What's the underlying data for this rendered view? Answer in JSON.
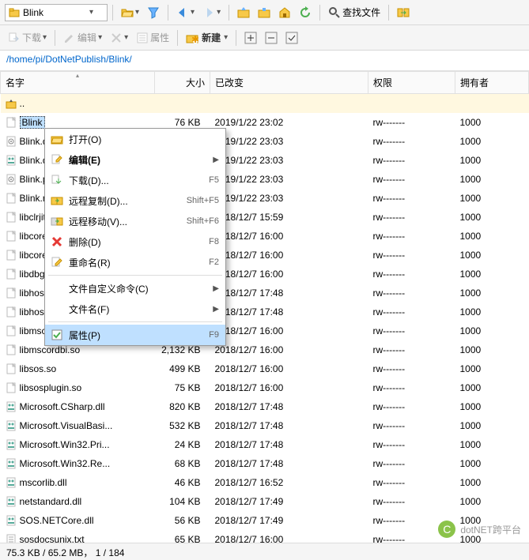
{
  "toolbar": {
    "folder_name": "Blink",
    "find_files": "查找文件"
  },
  "toolbar2": {
    "download": "下载",
    "edit": "编辑",
    "properties": "属性",
    "new": "新建"
  },
  "path": "/home/pi/DotNetPublish/Blink/",
  "columns": {
    "name": "名字",
    "size": "大小",
    "changed": "已改变",
    "perm": "权限",
    "owner": "拥有者"
  },
  "parent_row": "..",
  "files": [
    {
      "name": "Blink",
      "size": "76 KB",
      "changed": "2019/1/22 23:02",
      "perm": "rw-------",
      "owner": "1000",
      "icon": "file",
      "selected": true
    },
    {
      "name": "Blink.deps.json",
      "size": "",
      "changed": "2019/1/22 23:03",
      "perm": "rw-------",
      "owner": "1000",
      "icon": "config"
    },
    {
      "name": "Blink.dll",
      "size": "",
      "changed": "2019/1/22 23:03",
      "perm": "rw-------",
      "owner": "1000",
      "icon": "dll"
    },
    {
      "name": "Blink.pdb",
      "size": "",
      "changed": "2019/1/22 23:03",
      "perm": "rw-------",
      "owner": "1000",
      "icon": "config"
    },
    {
      "name": "Blink.runtimeconfig...",
      "size": "",
      "changed": "2019/1/22 23:03",
      "perm": "rw-------",
      "owner": "1000",
      "icon": "file"
    },
    {
      "name": "libclrjit.so",
      "size": "",
      "changed": "2018/12/7 15:59",
      "perm": "rw-------",
      "owner": "1000",
      "icon": "file"
    },
    {
      "name": "libcoreclr.so",
      "size": "",
      "changed": "2018/12/7 16:00",
      "perm": "rw-------",
      "owner": "1000",
      "icon": "file"
    },
    {
      "name": "libcoreclrtracept...",
      "size": "",
      "changed": "2018/12/7 16:00",
      "perm": "rw-------",
      "owner": "1000",
      "icon": "file"
    },
    {
      "name": "libdbgshim.so",
      "size": "",
      "changed": "2018/12/7 16:00",
      "perm": "rw-------",
      "owner": "1000",
      "icon": "file"
    },
    {
      "name": "libhostfxr.so",
      "size": "",
      "changed": "2018/12/7 17:48",
      "perm": "rw-------",
      "owner": "1000",
      "icon": "file"
    },
    {
      "name": "libhostpolicy.so",
      "size": "",
      "changed": "2018/12/7 17:48",
      "perm": "rw-------",
      "owner": "1000",
      "icon": "file"
    },
    {
      "name": "libmscordaccore.so",
      "size": "",
      "changed": "2018/12/7 16:00",
      "perm": "rw-------",
      "owner": "1000",
      "icon": "file"
    },
    {
      "name": "libmscordbi.so",
      "size": "2,132 KB",
      "changed": "2018/12/7 16:00",
      "perm": "rw-------",
      "owner": "1000",
      "icon": "file"
    },
    {
      "name": "libsos.so",
      "size": "499 KB",
      "changed": "2018/12/7 16:00",
      "perm": "rw-------",
      "owner": "1000",
      "icon": "file"
    },
    {
      "name": "libsosplugin.so",
      "size": "75 KB",
      "changed": "2018/12/7 16:00",
      "perm": "rw-------",
      "owner": "1000",
      "icon": "file"
    },
    {
      "name": "Microsoft.CSharp.dll",
      "size": "820 KB",
      "changed": "2018/12/7 17:48",
      "perm": "rw-------",
      "owner": "1000",
      "icon": "dll"
    },
    {
      "name": "Microsoft.VisualBasi...",
      "size": "532 KB",
      "changed": "2018/12/7 17:48",
      "perm": "rw-------",
      "owner": "1000",
      "icon": "dll"
    },
    {
      "name": "Microsoft.Win32.Pri...",
      "size": "24 KB",
      "changed": "2018/12/7 17:48",
      "perm": "rw-------",
      "owner": "1000",
      "icon": "dll"
    },
    {
      "name": "Microsoft.Win32.Re...",
      "size": "68 KB",
      "changed": "2018/12/7 17:48",
      "perm": "rw-------",
      "owner": "1000",
      "icon": "dll"
    },
    {
      "name": "mscorlib.dll",
      "size": "46 KB",
      "changed": "2018/12/7 16:52",
      "perm": "rw-------",
      "owner": "1000",
      "icon": "dll"
    },
    {
      "name": "netstandard.dll",
      "size": "104 KB",
      "changed": "2018/12/7 17:49",
      "perm": "rw-------",
      "owner": "1000",
      "icon": "dll"
    },
    {
      "name": "SOS.NETCore.dll",
      "size": "56 KB",
      "changed": "2018/12/7 17:49",
      "perm": "rw-------",
      "owner": "1000",
      "icon": "dll"
    },
    {
      "name": "sosdocsunix.txt",
      "size": "65 KB",
      "changed": "2018/12/7 16:00",
      "perm": "rw-------",
      "owner": "1000",
      "icon": "txt"
    }
  ],
  "context_menu": [
    {
      "label": "打开(O)",
      "icon": "folder-open"
    },
    {
      "label": "编辑(E)",
      "icon": "edit",
      "bold": true,
      "submenu": true
    },
    {
      "label": "下载(D)...",
      "icon": "download",
      "shortcut": "F5"
    },
    {
      "label": "远程复制(D)...",
      "icon": "copy-remote",
      "shortcut": "Shift+F5"
    },
    {
      "label": "远程移动(V)...",
      "icon": "move-remote",
      "shortcut": "Shift+F6"
    },
    {
      "label": "删除(D)",
      "icon": "delete",
      "shortcut": "F8"
    },
    {
      "label": "重命名(R)",
      "icon": "rename",
      "shortcut": "F2"
    },
    {
      "sep": true
    },
    {
      "label": "文件自定义命令(C)",
      "submenu": true
    },
    {
      "label": "文件名(F)",
      "submenu": true
    },
    {
      "sep": true
    },
    {
      "label": "属性(P)",
      "icon": "properties",
      "shortcut": "F9",
      "highlighted": true
    }
  ],
  "status": "75.3 KB / 65.2 MB，  1 / 184",
  "watermark": "dotNET跨平台"
}
